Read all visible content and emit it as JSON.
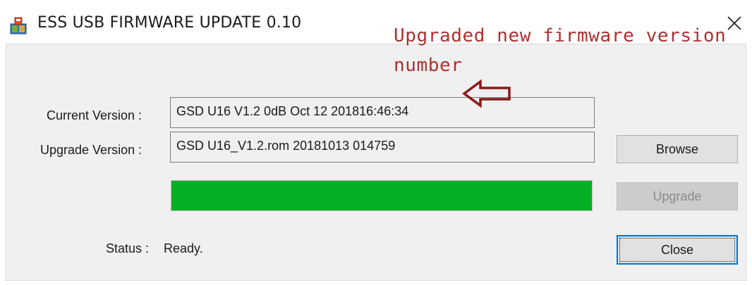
{
  "window": {
    "title": "ESS USB FIRMWARE UPDATE 0.10"
  },
  "annotation": {
    "line1": "Upgraded new firmware version",
    "line2": "number",
    "color": "#b03030"
  },
  "form": {
    "current_version_label": "Current Version :",
    "current_version_value": "GSD U16 V1.2 0dB Oct 12 201816:46:34",
    "upgrade_version_label": "Upgrade Version :",
    "upgrade_version_value": "GSD U16_V1.2.rom 20181013 014759",
    "status_label": "Status :",
    "status_value": "Ready."
  },
  "progress": {
    "percent": 100,
    "color": "#06b025"
  },
  "buttons": {
    "browse": "Browse",
    "upgrade": "Upgrade",
    "upgrade_enabled": false,
    "close": "Close"
  },
  "icons": {
    "app": "usb-installer-icon",
    "close": "close-icon",
    "annotation_arrow": "arrow-left-icon"
  }
}
